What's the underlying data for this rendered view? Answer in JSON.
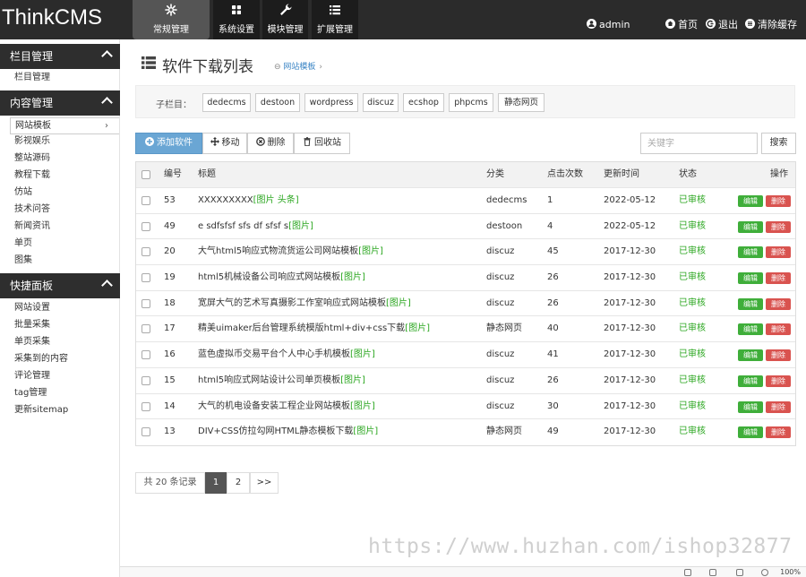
{
  "app": {
    "logo": "ThinkCMS"
  },
  "topnav": [
    {
      "label": "常规管理",
      "icon": "asterisk-icon"
    },
    {
      "label": "系统设置",
      "icon": "grid-icon"
    },
    {
      "label": "模块管理",
      "icon": "wrench-icon"
    },
    {
      "label": "扩展管理",
      "icon": "list-icon"
    }
  ],
  "toplinks": {
    "user": "admin",
    "home": "首页",
    "logout": "退出",
    "clear": "清除缓存"
  },
  "sidebar": {
    "sections": [
      {
        "title": "栏目管理",
        "items": [
          "栏目管理"
        ]
      },
      {
        "title": "内容管理",
        "items": [
          "网站模板",
          "影视娱乐",
          "整站源码",
          "教程下载",
          "仿站",
          "技术问答",
          "新闻资讯",
          "单页",
          "图集"
        ]
      },
      {
        "title": "快捷面板",
        "items": [
          "网站设置",
          "批量采集",
          "单页采集",
          "采集到的内容",
          "评论管理",
          "tag管理",
          "更新sitemap"
        ]
      }
    ],
    "active_item": "网站模板"
  },
  "page": {
    "title": "软件下载列表",
    "breadcrumb": "网站模板"
  },
  "subcategories": {
    "label": "子栏目：",
    "tags": [
      "dedecms",
      "destoon",
      "wordpress",
      "discuz",
      "ecshop",
      "phpcms",
      "静态网页"
    ]
  },
  "toolbar": {
    "add": "添加软件",
    "move": "移动",
    "delete": "删除",
    "recycle": "回收站"
  },
  "search": {
    "placeholder": "关键字",
    "button": "搜索"
  },
  "table": {
    "headers": {
      "id": "编号",
      "title": "标题",
      "category": "分类",
      "hits": "点击次数",
      "updated": "更新时间",
      "status": "状态",
      "ops": "操作"
    },
    "edit_label": "编辑",
    "delete_label": "删除",
    "rows": [
      {
        "id": "53",
        "title": "XXXXXXXXX",
        "tag": "[图片 头条]",
        "category": "dedecms",
        "hits": "1",
        "updated": "2022-05-12",
        "status": "已审核"
      },
      {
        "id": "49",
        "title": "e sdfsfsf sfs df sfsf s",
        "tag": "[图片]",
        "category": "destoon",
        "hits": "4",
        "updated": "2022-05-12",
        "status": "已审核"
      },
      {
        "id": "20",
        "title": "大气html5响应式物流货运公司网站模板",
        "tag": "[图片]",
        "category": "discuz",
        "hits": "45",
        "updated": "2017-12-30",
        "status": "已审核"
      },
      {
        "id": "19",
        "title": "html5机械设备公司响应式网站模板",
        "tag": "[图片]",
        "category": "discuz",
        "hits": "26",
        "updated": "2017-12-30",
        "status": "已审核"
      },
      {
        "id": "18",
        "title": "宽屏大气的艺术写真摄影工作室响应式网站模板",
        "tag": "[图片]",
        "category": "discuz",
        "hits": "26",
        "updated": "2017-12-30",
        "status": "已审核"
      },
      {
        "id": "17",
        "title": "精美uimaker后台管理系统模版html+div+css下载",
        "tag": "[图片]",
        "category": "静态网页",
        "hits": "40",
        "updated": "2017-12-30",
        "status": "已审核"
      },
      {
        "id": "16",
        "title": "蓝色虚拟币交易平台个人中心手机模板",
        "tag": "[图片]",
        "category": "discuz",
        "hits": "41",
        "updated": "2017-12-30",
        "status": "已审核"
      },
      {
        "id": "15",
        "title": "html5响应式网站设计公司单页模板",
        "tag": "[图片]",
        "category": "discuz",
        "hits": "26",
        "updated": "2017-12-30",
        "status": "已审核"
      },
      {
        "id": "14",
        "title": "大气的机电设备安装工程企业网站模板",
        "tag": "[图片]",
        "category": "discuz",
        "hits": "30",
        "updated": "2017-12-30",
        "status": "已审核"
      },
      {
        "id": "13",
        "title": "DIV+CSS仿拉勾网HTML静态模板下载",
        "tag": "[图片]",
        "category": "静态网页",
        "hits": "49",
        "updated": "2017-12-30",
        "status": "已审核"
      }
    ]
  },
  "pagination": {
    "info": "共 20 条记录",
    "pages": [
      "1",
      "2"
    ],
    "next": ">>",
    "current": "1"
  },
  "watermark": "https://www.huzhan.com/ishop32877",
  "statusbar": {
    "zoom": "100%"
  },
  "colors": {
    "accent": "#6aa6d4",
    "success": "#3fae3a",
    "danger": "#d9534f",
    "status_green": "#2aa61f",
    "topbar": "#2b2b2b"
  }
}
